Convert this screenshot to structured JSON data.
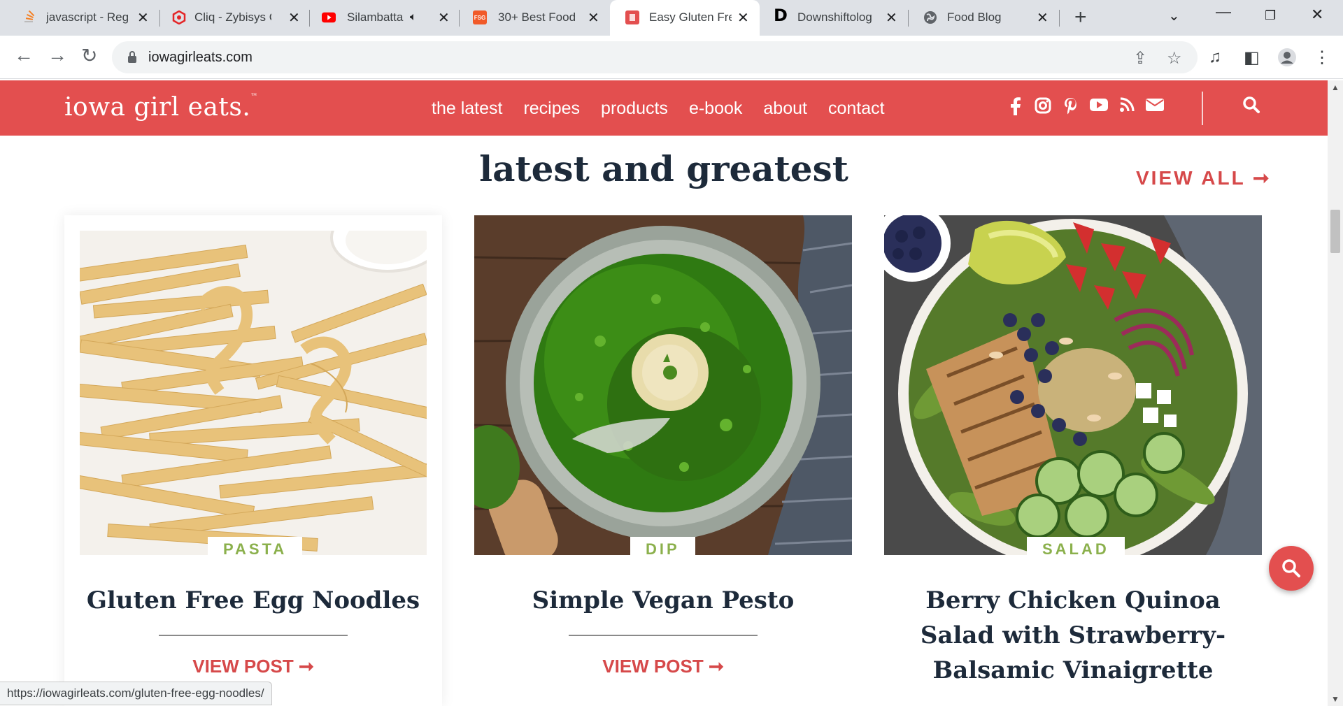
{
  "browser": {
    "tabs": [
      {
        "title": "javascript - Reg",
        "favicon": "stackoverflow-icon",
        "color": "#f48024"
      },
      {
        "title": "Cliq - Zybisys C",
        "favicon": "cliq-icon",
        "color": "#e42527"
      },
      {
        "title": "Silambatta",
        "favicon": "youtube-icon",
        "color": "#ff0000"
      },
      {
        "title": "30+ Best Food",
        "favicon": "fsg-icon",
        "favicon_text": "FSG",
        "color": "#f15a29"
      },
      {
        "title": "Easy Gluten Fre",
        "favicon": "iowagirleats-icon",
        "color": "#e34f4f"
      },
      {
        "title": "Downshiftolog",
        "favicon": "downshiftology-icon",
        "favicon_text": "D",
        "color": "#000000"
      },
      {
        "title": "Food Blog",
        "favicon": "globe-icon",
        "color": "#5f6368"
      }
    ],
    "active_tab_index": 4,
    "url": "iowagirleats.com",
    "status_url": "https://iowagirleats.com/gluten-free-egg-noodles/"
  },
  "site": {
    "logo": "iowa girl eats.",
    "logo_tm": "™",
    "nav": [
      "the latest",
      "recipes",
      "products",
      "e-book",
      "about",
      "contact"
    ],
    "social": [
      "facebook-icon",
      "instagram-icon",
      "pinterest-icon",
      "youtube-icon",
      "rss-icon",
      "email-icon"
    ],
    "brand_color": "#e34f4f",
    "accent_green": "#8bb04c"
  },
  "section": {
    "title": "latest and greatest",
    "view_all": "VIEW ALL ➞"
  },
  "cards": [
    {
      "category": "PASTA",
      "title": "Gluten Free Egg Noodles",
      "cta": "VIEW POST ➞"
    },
    {
      "category": "DIP",
      "title": "Simple Vegan Pesto",
      "cta": "VIEW POST ➞"
    },
    {
      "category": "SALAD",
      "title_lines": [
        "Berry Chicken Quinoa",
        "Salad with Strawberry-",
        "Balsamic Vinaigrette"
      ]
    }
  ]
}
